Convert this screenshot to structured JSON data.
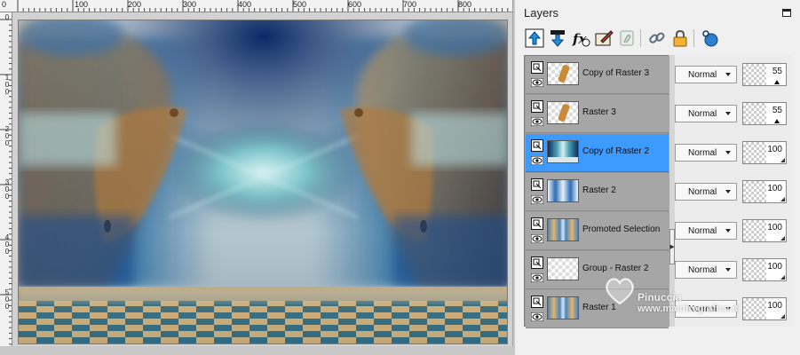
{
  "canvas": {
    "ruler_top_labels": [
      "0",
      "100",
      "200",
      "300",
      "400",
      "500",
      "600",
      "700",
      "800"
    ],
    "ruler_left_labels": [
      "0",
      "1\n0\n0",
      "2\n0\n0",
      "3\n0\n0",
      "4\n0\n0",
      "5\n0\n0"
    ]
  },
  "panel": {
    "title": "Layers",
    "toolbar_icons": [
      {
        "name": "move-layer-up-icon"
      },
      {
        "name": "move-layer-down-icon"
      },
      {
        "name": "layer-effects-icon"
      },
      {
        "name": "edit-layer-icon"
      },
      {
        "name": "mask-icon"
      },
      {
        "name": "link-layer-icon"
      },
      {
        "name": "lock-layer-icon"
      },
      {
        "name": "view-layer-icon"
      }
    ]
  },
  "layers": [
    {
      "name": "Copy of Raster 3",
      "blend": "Normal",
      "opacity": "55",
      "opacity_fraction": 0.55,
      "selected": false,
      "thumb": "checker-figure"
    },
    {
      "name": "Raster 3",
      "blend": "Normal",
      "opacity": "55",
      "opacity_fraction": 0.55,
      "selected": false,
      "thumb": "checker-figure"
    },
    {
      "name": "Copy of Raster 2",
      "blend": "Normal",
      "opacity": "100",
      "opacity_fraction": 1.0,
      "selected": true,
      "thumb": "blue-dark"
    },
    {
      "name": "Raster 2",
      "blend": "Normal",
      "opacity": "100",
      "opacity_fraction": 1.0,
      "selected": false,
      "thumb": "blue-light"
    },
    {
      "name": "Promoted Selection",
      "blend": "Normal",
      "opacity": "100",
      "opacity_fraction": 1.0,
      "selected": false,
      "thumb": "gold-blue"
    },
    {
      "name": "Group - Raster 2",
      "blend": "Normal",
      "opacity": "100",
      "opacity_fraction": 1.0,
      "selected": false,
      "thumb": "checker"
    },
    {
      "name": "Raster 1",
      "blend": "Normal",
      "opacity": "100",
      "opacity_fraction": 1.0,
      "selected": false,
      "thumb": "gold-blue"
    }
  ],
  "watermark": {
    "line1": "Pinuccia",
    "line2": "www.maidiregrafica.it"
  },
  "colors": {
    "selected_row": "#3d9bff",
    "list_background": "#9e9e9e",
    "panel_background": "#f0f0f0"
  }
}
